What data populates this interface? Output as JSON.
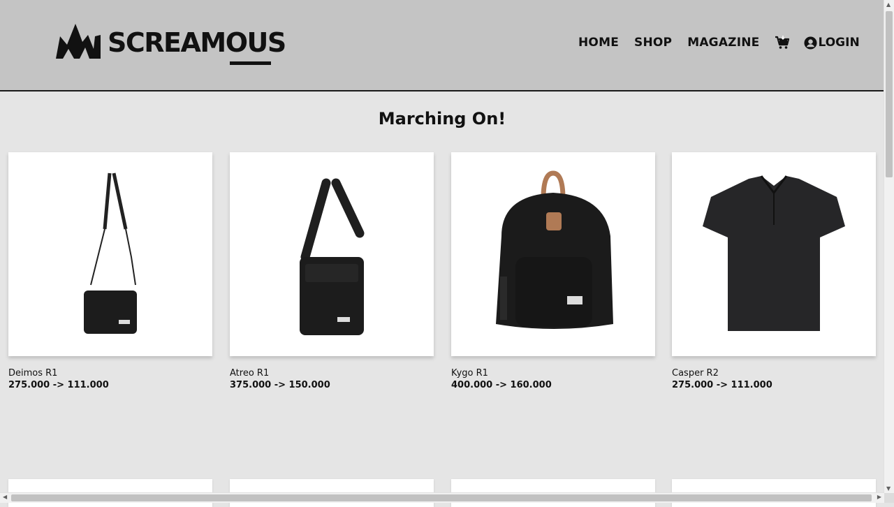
{
  "brand": {
    "name": "SCREAMOUS"
  },
  "nav": {
    "items": [
      "HOME",
      "SHOP",
      "MAGAZINE"
    ],
    "cart_icon": "cart-icon",
    "login_label": "LOGIN",
    "login_icon": "user-circle-icon"
  },
  "section": {
    "title": "Marching On!"
  },
  "products": [
    {
      "name": "Deimos R1",
      "price": "275.000 -> 111.000",
      "image": "sling-bag"
    },
    {
      "name": "Atreo R1",
      "price": "375.000 -> 150.000",
      "image": "messenger-bag"
    },
    {
      "name": "Kygo R1",
      "price": "400.000 -> 160.000",
      "image": "backpack"
    },
    {
      "name": "Casper R2",
      "price": "275.000 -> 111.000",
      "image": "polo-shirt"
    }
  ],
  "colors": {
    "header_bg": "#c4c4c4",
    "page_bg": "#e5e5e5",
    "text": "#111111",
    "tag": "#b07a55"
  }
}
